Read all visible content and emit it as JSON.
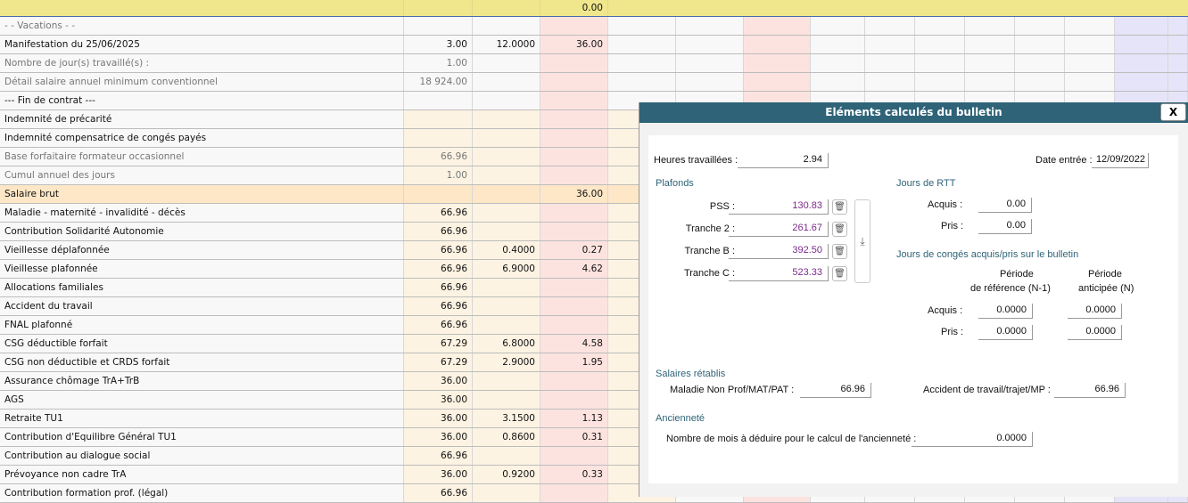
{
  "header_row": {
    "c3": "0.00"
  },
  "rows": [
    {
      "label": "- - Vacations - -",
      "c1": "",
      "c2": "",
      "c3": "",
      "style": "grey"
    },
    {
      "label": "Manifestation du 25/06/2025",
      "c1": "3.00",
      "c2": "12.0000",
      "c3": "36.00",
      "style": "normal"
    },
    {
      "label": "Nombre de jour(s) travaillé(s) :",
      "c1": "1.00",
      "c2": "",
      "c3": "",
      "style": "grey"
    },
    {
      "label": "Détail salaire annuel minimum conventionnel",
      "c1": "18 924.00",
      "c2": "",
      "c3": "",
      "style": "grey"
    },
    {
      "label": "--- Fin de contrat ---",
      "c1": "",
      "c2": "",
      "c3": "",
      "style": "normal"
    },
    {
      "label": "Indemnité de précarité",
      "c1": "",
      "c2": "",
      "c3": "",
      "style": "normal"
    },
    {
      "label": "Indemnité compensatrice de congés payés",
      "c1": "",
      "c2": "",
      "c3": "",
      "style": "normal"
    },
    {
      "label": "Base forfaitaire formateur occasionnel",
      "c1": "66.96",
      "c2": "",
      "c3": "",
      "style": "grey"
    },
    {
      "label": "Cumul annuel des jours",
      "c1": "1.00",
      "c2": "",
      "c3": "",
      "style": "grey"
    },
    {
      "label": "Salaire brut",
      "c1": "",
      "c2": "",
      "c3": "36.00",
      "style": "brut"
    },
    {
      "label": "Maladie - maternité - invalidité - décès",
      "c1": "66.96",
      "c2": "",
      "c3": "",
      "style": "normal"
    },
    {
      "label": "Contribution Solidarité Autonomie",
      "c1": "66.96",
      "c2": "",
      "c3": "",
      "style": "normal"
    },
    {
      "label": "Vieillesse déplafonnée",
      "c1": "66.96",
      "c2": "0.4000",
      "c3": "0.27",
      "style": "normal"
    },
    {
      "label": "Vieillesse plafonnée",
      "c1": "66.96",
      "c2": "6.9000",
      "c3": "4.62",
      "style": "normal"
    },
    {
      "label": "Allocations familiales",
      "c1": "66.96",
      "c2": "",
      "c3": "",
      "style": "normal"
    },
    {
      "label": "Accident du travail",
      "c1": "66.96",
      "c2": "",
      "c3": "",
      "style": "normal"
    },
    {
      "label": "FNAL plafonné",
      "c1": "66.96",
      "c2": "",
      "c3": "",
      "style": "normal"
    },
    {
      "label": "CSG déductible forfait",
      "c1": "67.29",
      "c2": "6.8000",
      "c3": "4.58",
      "style": "normal"
    },
    {
      "label": "CSG non déductible et CRDS forfait",
      "c1": "67.29",
      "c2": "2.9000",
      "c3": "1.95",
      "style": "normal"
    },
    {
      "label": "Assurance chômage TrA+TrB",
      "c1": "36.00",
      "c2": "",
      "c3": "",
      "style": "normal"
    },
    {
      "label": "AGS",
      "c1": "36.00",
      "c2": "",
      "c3": "",
      "style": "normal"
    },
    {
      "label": "Retraite TU1",
      "c1": "36.00",
      "c2": "3.1500",
      "c3": "1.13",
      "style": "normal"
    },
    {
      "label": "Contribution d'Equilibre Général TU1",
      "c1": "36.00",
      "c2": "0.8600",
      "c3": "0.31",
      "style": "normal"
    },
    {
      "label": "Contribution au dialogue social",
      "c1": "66.96",
      "c2": "",
      "c3": "",
      "style": "normal"
    },
    {
      "label": "Prévoyance non cadre TrA",
      "c1": "36.00",
      "c2": "0.9200",
      "c3": "0.33",
      "style": "normal"
    },
    {
      "label": "Contribution formation prof. (légal)",
      "c1": "66.96",
      "c2": "",
      "c3": "",
      "style": "normal"
    }
  ],
  "dialog": {
    "title": "Eléments calculés du bulletin",
    "close": "X",
    "heures_label": "Heures travaillées :",
    "heures": "2.94",
    "date_label": "Date entrée :",
    "date": "12/09/2022",
    "plafonds_title": "Plafonds",
    "plafonds": [
      {
        "label": "PSS :",
        "value": "130.83"
      },
      {
        "label": "Tranche 2 :",
        "value": "261.67"
      },
      {
        "label": "Tranche B :",
        "value": "392.50"
      },
      {
        "label": "Tranche C :",
        "value": "523.33"
      }
    ],
    "rtt_title": "Jours de RTT",
    "rtt_acquis_label": "Acquis :",
    "rtt_acquis": "0.00",
    "rtt_pris_label": "Pris :",
    "rtt_pris": "0.00",
    "conges_title": "Jours de congés acquis/pris sur le bulletin",
    "col_ref_1": "Période",
    "col_ref_2": "de référence (N-1)",
    "col_ant_1": "Période",
    "col_ant_2": "anticipée (N)",
    "conges_acquis_label": "Acquis :",
    "conges_acquis_ref": "0.0000",
    "conges_acquis_ant": "0.0000",
    "conges_pris_label": "Pris :",
    "conges_pris_ref": "0.0000",
    "conges_pris_ant": "0.0000",
    "salaires_title": "Salaires rétablis",
    "maladie_label": "Maladie Non Prof/MAT/PAT :",
    "maladie": "66.96",
    "accident_label": "Accident de travail/trajet/MP :",
    "accident": "66.96",
    "anciennete_title": "Ancienneté",
    "anciennete_label": "Nombre de mois à déduire pour le calcul de l'ancienneté :",
    "anciennete": "0.0000"
  }
}
